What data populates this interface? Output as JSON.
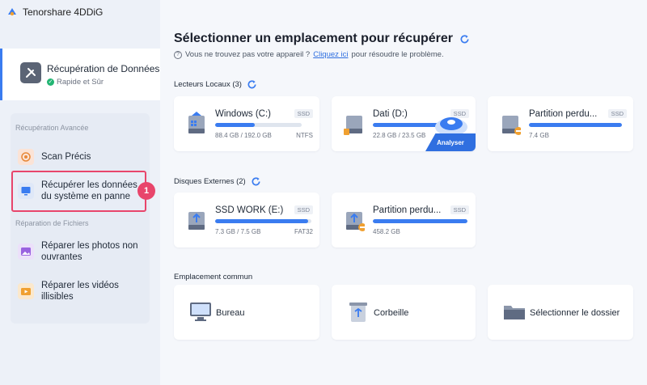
{
  "app": {
    "title": "Tenorshare 4DDiG"
  },
  "sidebar": {
    "primary": {
      "title": "Récupération de Données",
      "subtitle": "Rapide et Sûr"
    },
    "sections": [
      {
        "label": "Récupération Avancée"
      },
      {
        "label": "Réparation de Fichiers"
      }
    ],
    "items": [
      {
        "line1": "Scan Précis",
        "line2": ""
      },
      {
        "line1": "Récupérer les données",
        "line2": "du système en panne"
      },
      {
        "line1": "Réparer les photos non",
        "line2": "ouvrantes"
      },
      {
        "line1": "Réparer les vidéos",
        "line2": "illisibles"
      }
    ],
    "step_badge": "1"
  },
  "main": {
    "title": "Sélectionner un emplacement pour récupérer",
    "help": {
      "prefix": "Vous ne trouvez pas votre appareil ?",
      "link": "Cliquez ici",
      "suffix": "pour résoudre le problème."
    },
    "local": {
      "label": "Lecteurs Locaux (3)",
      "drives": [
        {
          "name": "Windows (C:)",
          "tag": "SSD",
          "size": "88.4 GB / 192.0 GB",
          "fs": "NTFS",
          "fill": 0.46
        },
        {
          "name": "Dati (D:)",
          "tag": "SSD",
          "size": "22.8 GB / 23.5 GB",
          "fs": "",
          "fill": 0.97,
          "action": "Analyser"
        },
        {
          "name": "Partition perdu...",
          "tag": "SSD",
          "size": "7.4 GB",
          "fs": "",
          "fill": 1.0
        }
      ]
    },
    "external": {
      "label": "Disques Externes (2)",
      "drives": [
        {
          "name": "SSD WORK (E:)",
          "tag": "SSD",
          "size": "7.3 GB / 7.5 GB",
          "fs": "FAT32",
          "fill": 0.97
        },
        {
          "name": "Partition perdu...",
          "tag": "SSD",
          "size": "458.2 GB",
          "fs": "",
          "fill": 1.0
        }
      ]
    },
    "common": {
      "label": "Emplacement commun",
      "locations": [
        {
          "name": "Bureau"
        },
        {
          "name": "Corbeille"
        },
        {
          "name": "Sélectionner le dossier"
        }
      ]
    }
  },
  "colors": {
    "accent": "#3a7cf0",
    "highlight": "#e8456b",
    "ok": "#22b573",
    "warn": "#f0a030"
  }
}
